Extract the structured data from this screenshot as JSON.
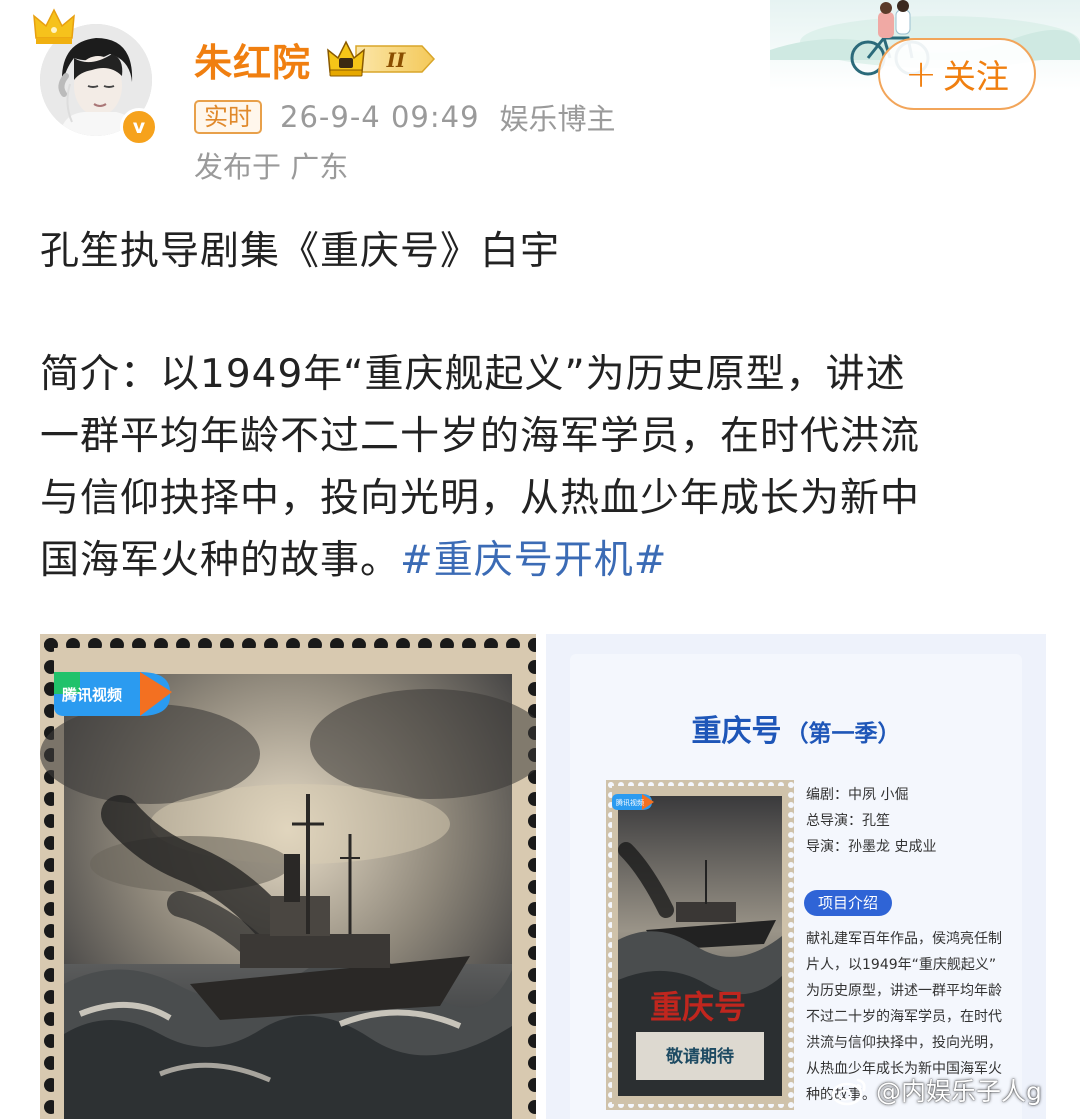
{
  "header": {
    "username": "朱红院",
    "level_badge": "II",
    "realtime_tag": "实时",
    "timestamp": "26-9-4 09:49",
    "role": "娱乐博主",
    "location": "发布于 广东",
    "follow_label": "关注"
  },
  "post": {
    "title": "孔笙执导剧集《重庆号》白宇",
    "desc_lines": [
      "简介：以1949年“重庆舰起义”为历史原型，讲述",
      "一群平均年龄不过二十岁的海军学员，在时代洪流",
      "与信仰抉择中，投向光明，从热血少年成长为新中",
      "国海军火种的故事。"
    ],
    "hashtag": "#重庆号开机#"
  },
  "image_left": {
    "platform_logo_text": "腾讯视频"
  },
  "image_right": {
    "title_main": "重庆号",
    "title_season": "（第一季）",
    "poster_logo_text": "腾讯视频",
    "poster_title": "重庆号",
    "poster_slogan": "敬请期待",
    "credits": [
      "编剧：中夙 小倔",
      "总导演：孔笙",
      "导演：孙墨龙 史成业"
    ],
    "project_tag": "项目介绍",
    "project_lines": [
      "献礼建军百年作品，侯鸿亮任制",
      "片人，以1949年“重庆舰起义”",
      "为历史原型，讲述一群平均年龄",
      "不过二十岁的海军学员，在时代",
      "洪流与信仰抉择中，投向光明，",
      "从热血少年成长为新中国海军火",
      "种的故事。"
    ]
  },
  "watermark": "@内娱乐子人g",
  "colors": {
    "username": "#f07f10",
    "meta_gray": "#9a9a9a",
    "hashtag": "#3b6bb5",
    "card_blue": "#1e56b8",
    "tag_blue": "#2f64d6"
  }
}
